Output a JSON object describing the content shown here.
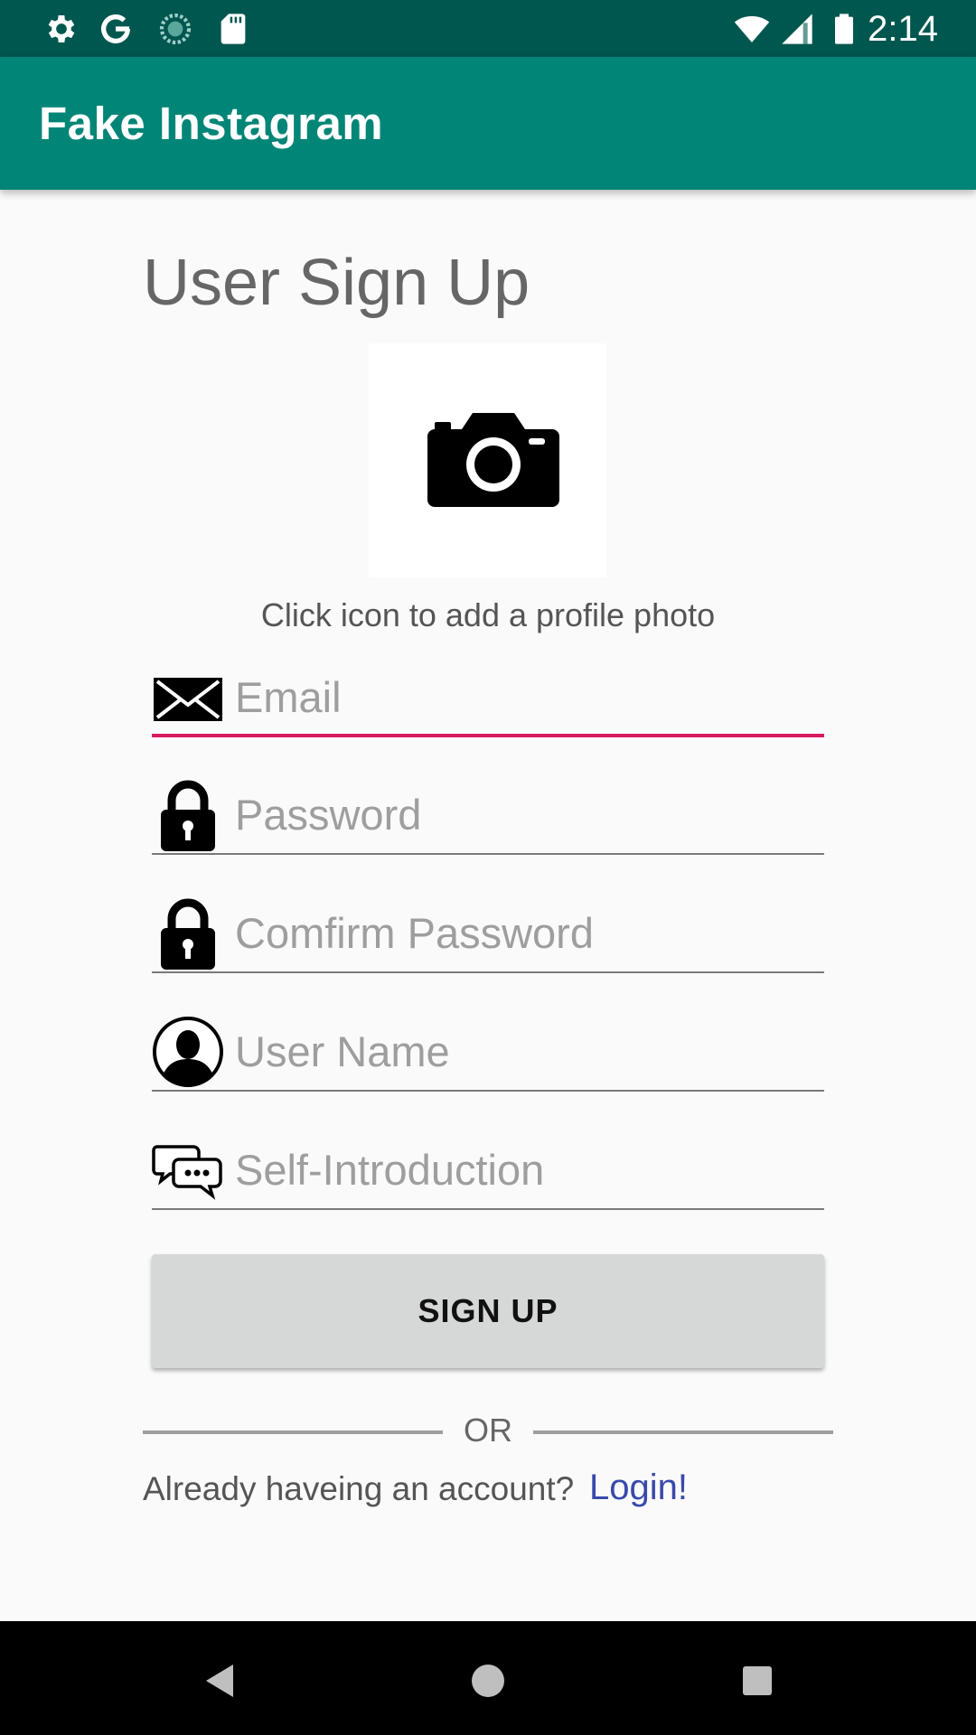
{
  "status_bar": {
    "time": "2:14",
    "left_icons": [
      "gear-icon",
      "google-icon",
      "sync-icon",
      "sd-card-icon"
    ],
    "right_icons": [
      "wifi-icon",
      "signal-icon",
      "battery-icon"
    ]
  },
  "app_bar": {
    "title": "Fake Instagram",
    "color": "#008577"
  },
  "page": {
    "title": "User Sign Up",
    "photo_hint": "Click icon to add a profile photo"
  },
  "form": {
    "email": {
      "placeholder": "Email",
      "icon": "envelope-icon"
    },
    "password": {
      "placeholder": "Password",
      "icon": "lock-icon"
    },
    "confirm_password": {
      "placeholder": "Comfirm Password",
      "icon": "lock-icon"
    },
    "username": {
      "placeholder": "User Name",
      "icon": "person-icon"
    },
    "intro": {
      "placeholder": "Self-Introduction",
      "icon": "chat-icon"
    }
  },
  "signup_button": "SIGN UP",
  "divider_text": "OR",
  "footer": {
    "prompt": "Already haveing an account?",
    "login_link": "Login!"
  },
  "colors": {
    "accent": "#d81b60",
    "primary": "#008577",
    "primary_dark": "#00574f",
    "link": "#3949ab"
  }
}
